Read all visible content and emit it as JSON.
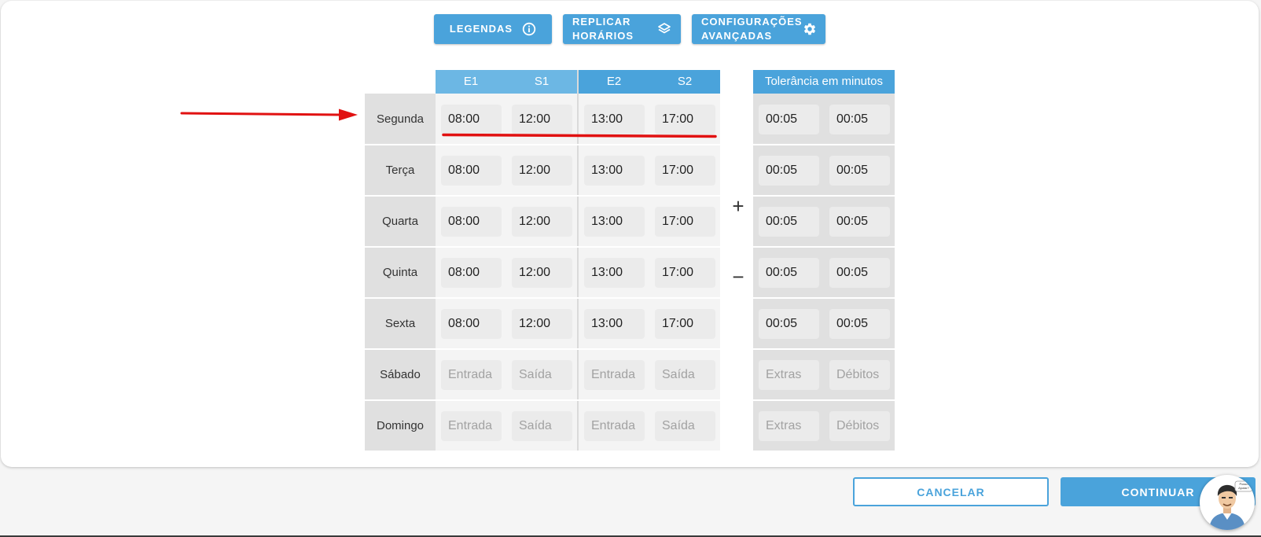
{
  "toolbar": {
    "legendas_label": "LEGENDAS",
    "replicar_label": "REPLICAR\nHORÁRIOS",
    "config_label": "CONFIGURAÇÕES\nAVANÇADAS"
  },
  "table": {
    "headers": [
      "E1",
      "S1",
      "E2",
      "S2"
    ],
    "tolerance_header": "Tolerância em minutos",
    "rows": [
      {
        "day": "Segunda",
        "e1": "08:00",
        "s1": "12:00",
        "e2": "13:00",
        "s2": "17:00",
        "extras": "00:05",
        "debitos": "00:05"
      },
      {
        "day": "Terça",
        "e1": "08:00",
        "s1": "12:00",
        "e2": "13:00",
        "s2": "17:00",
        "extras": "00:05",
        "debitos": "00:05"
      },
      {
        "day": "Quarta",
        "e1": "08:00",
        "s1": "12:00",
        "e2": "13:00",
        "s2": "17:00",
        "extras": "00:05",
        "debitos": "00:05"
      },
      {
        "day": "Quinta",
        "e1": "08:00",
        "s1": "12:00",
        "e2": "13:00",
        "s2": "17:00",
        "extras": "00:05",
        "debitos": "00:05"
      },
      {
        "day": "Sexta",
        "e1": "08:00",
        "s1": "12:00",
        "e2": "13:00",
        "s2": "17:00",
        "extras": "00:05",
        "debitos": "00:05"
      },
      {
        "day": "Sábado",
        "e1": "",
        "s1": "",
        "e2": "",
        "s2": "",
        "extras": "",
        "debitos": ""
      },
      {
        "day": "Domingo",
        "e1": "",
        "s1": "",
        "e2": "",
        "s2": "",
        "extras": "",
        "debitos": ""
      }
    ],
    "placeholders": {
      "entrada": "Entrada",
      "saida": "Saída",
      "extras": "Extras",
      "debitos": "Débitos"
    }
  },
  "controls": {
    "add_symbol": "+",
    "remove_symbol": "−"
  },
  "footer": {
    "cancel_label": "CANCELAR",
    "continue_label": "CONTINUAR"
  },
  "avatar": {
    "bubble_text": "Posso Ajudar?"
  },
  "icons": {
    "legendas": "info-icon",
    "replicar": "layers-icon",
    "config": "gear-icon"
  },
  "colors": {
    "primary": "#4aa3db",
    "header_light": "#6cb7e4",
    "annotation": "#e11111",
    "day_cell": "#e0e0e0",
    "input_bg": "#ebebeb"
  }
}
